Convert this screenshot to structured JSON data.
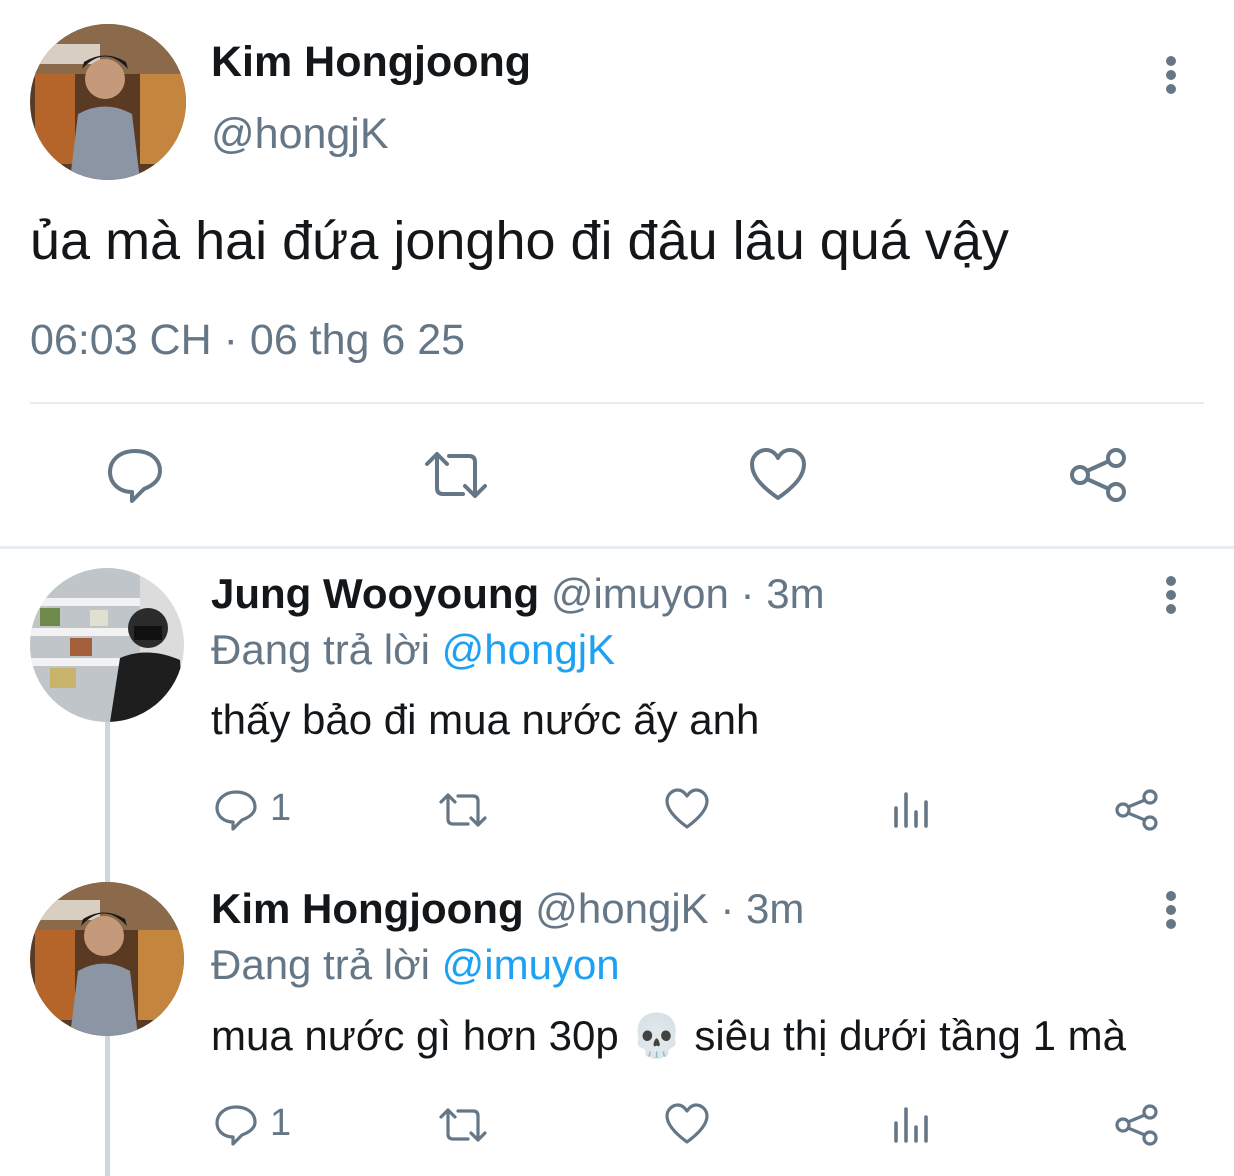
{
  "main_tweet": {
    "author_name": "Kim Hongjoong",
    "handle": "@hongjK",
    "text": "ủa mà hai đứa jongho đi đâu lâu quá vậy",
    "time": "06:03 CH",
    "separator": "·",
    "date": "06 thg 6 25",
    "actions": [
      "comment-icon",
      "retweet-icon",
      "like-icon",
      "share-icon"
    ]
  },
  "replies": [
    {
      "author_name": "Jung Wooyoung",
      "handle": "@imuyon",
      "separator": "·",
      "time": "3m",
      "replying_label": "Đang trả lời",
      "replying_to": "@hongjK",
      "text": "thấy bảo đi mua nước ấy anh",
      "reply_count": "1"
    },
    {
      "author_name": "Kim Hongjoong",
      "handle": "@hongjK",
      "separator": "·",
      "time": "3m",
      "replying_label": "Đang trả lời",
      "replying_to": "@imuyon",
      "text_before": "mua nước gì hơn 30p",
      "emoji": "💀",
      "text_after": "siêu thị dưới tầng 1 mà",
      "reply_count": "1"
    }
  ],
  "colors": {
    "text": "#14171a",
    "muted": "#657786",
    "link": "#1da1f2",
    "divider": "#e6ecf0"
  }
}
